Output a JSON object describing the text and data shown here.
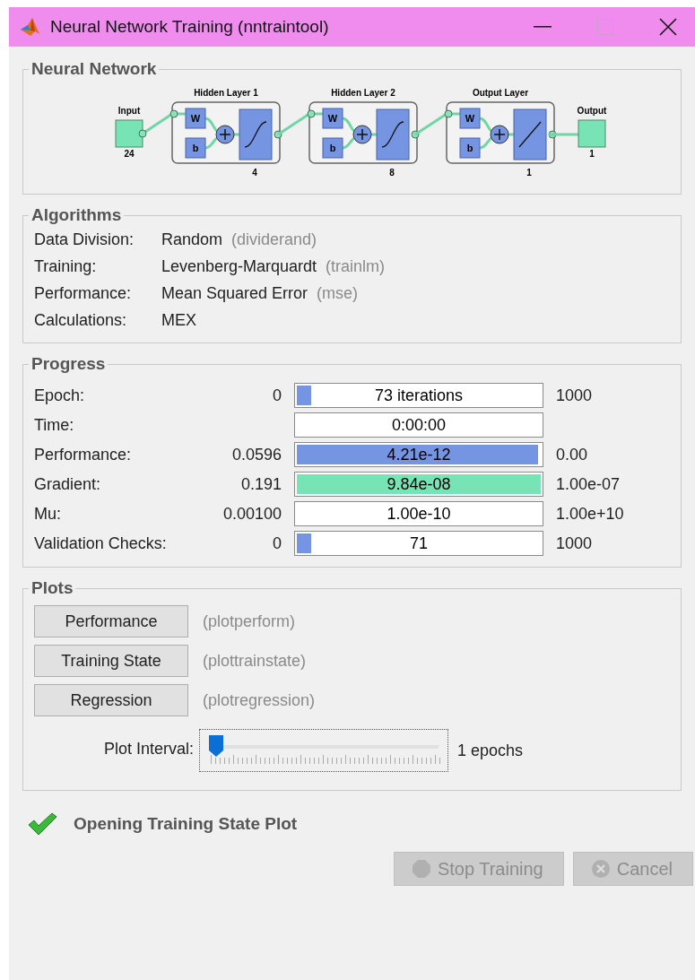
{
  "window": {
    "title": "Neural Network Training (nntraintool)"
  },
  "neural_network": {
    "title": "Neural Network",
    "input": {
      "label": "Input",
      "size": "24"
    },
    "layers": [
      {
        "title": "Hidden Layer 1",
        "weight": "W",
        "bias": "b",
        "size": "4",
        "kind": "sigmoid"
      },
      {
        "title": "Hidden Layer 2",
        "weight": "W",
        "bias": "b",
        "size": "8",
        "kind": "sigmoid"
      },
      {
        "title": "Output Layer",
        "weight": "W",
        "bias": "b",
        "size": "1",
        "kind": "linear"
      }
    ],
    "output": {
      "label": "Output",
      "size": "1"
    }
  },
  "algorithms": {
    "title": "Algorithms",
    "rows": [
      {
        "label": "Data Division:",
        "value": "Random",
        "function": "(dividerand)"
      },
      {
        "label": "Training:",
        "value": "Levenberg-Marquardt",
        "function": "(trainlm)"
      },
      {
        "label": "Performance:",
        "value": "Mean Squared Error",
        "function": "(mse)"
      },
      {
        "label": "Calculations:",
        "value": "MEX"
      }
    ]
  },
  "progress": {
    "title": "Progress",
    "rows": [
      {
        "label": "Epoch:",
        "start": "0",
        "reading": "73 iterations",
        "end": "1000",
        "level": 0.073,
        "color": "#7595e3"
      },
      {
        "label": "Time:",
        "reading": "0:00:00"
      },
      {
        "label": "Performance:",
        "start": "0.0596",
        "reading": "4.21e-12",
        "end": "0.00",
        "level": 0.99,
        "color": "#7595e3"
      },
      {
        "label": "Gradient:",
        "start": "0.191",
        "reading": "9.84e-08",
        "end": "1.00e-07",
        "level": 1,
        "color": "#78e3b4"
      },
      {
        "label": "Mu:",
        "start": "0.00100",
        "reading": "1.00e-10",
        "end": "1.00e+10"
      },
      {
        "label": "Validation Checks:",
        "start": "0",
        "reading": "71",
        "end": "1000",
        "level": 0.071,
        "color": "#7595e3"
      }
    ]
  },
  "plots": {
    "title": "Plots",
    "buttons": [
      {
        "label": "Performance",
        "function": "(plotperform)"
      },
      {
        "label": "Training State",
        "function": "(plottrainstate)"
      },
      {
        "label": "Regression",
        "function": "(plotregression)"
      }
    ],
    "interval": {
      "label": "Plot Interval:",
      "level": 0,
      "reading": "1 epochs"
    }
  },
  "status": {
    "text": "Opening Training State Plot",
    "ok": true
  },
  "buttons": [
    {
      "label": "Stop Training",
      "kind": "stop",
      "disabled": true
    },
    {
      "label": "Cancel",
      "kind": "cancel",
      "disabled": true
    }
  ]
}
